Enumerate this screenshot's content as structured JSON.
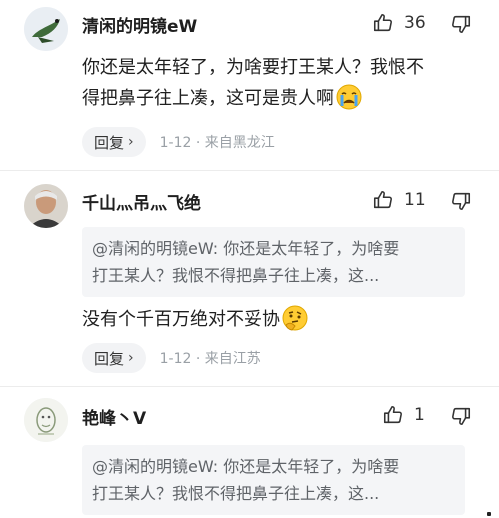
{
  "comments": [
    {
      "username": "清闲的明镜eW",
      "likes": "36",
      "text_line1": "你还是太年轻了，为啥要打王某人？我恨不",
      "text_line2": "得把鼻子往上凑，这可是贵人啊",
      "emoji": "crying-face",
      "reply_label": "回复",
      "meta": "1-12 · 来自黑龙江"
    },
    {
      "username": "千山灬吊灬飞绝",
      "likes": "11",
      "quote_line1": "@清闲的明镜eW: 你还是太年轻了，为啥要",
      "quote_line2": "打王某人？我恨不得把鼻子往上凑，这...",
      "text_line1": "没有个千百万绝对不妥协",
      "emoji": "thinking-face",
      "reply_label": "回复",
      "meta": "1-12 · 来自江苏"
    },
    {
      "username": "艳峰丶V",
      "likes": "1",
      "quote_line1": "@清闲的明镜eW: 你还是太年轻了，为啥要",
      "quote_line2": "打王某人？我恨不得把鼻子往上凑，这..."
    }
  ],
  "icons": {
    "like": "thumbs-up-icon",
    "dislike": "thumbs-down-icon",
    "reply_chevron": "chevron-right-icon"
  }
}
